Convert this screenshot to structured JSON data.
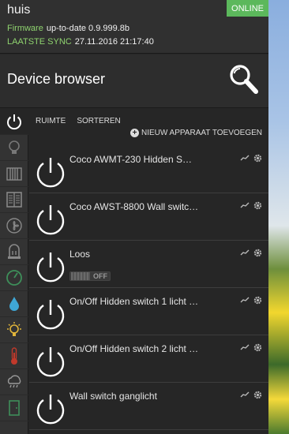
{
  "app": {
    "title": "huis",
    "status": "ONLINE"
  },
  "firmware": {
    "label": "Firmware",
    "value": "up-to-date 0.9.999.8b"
  },
  "sync": {
    "label": "LAATSTE SYNC",
    "value": "27.11.2016 21:17:40"
  },
  "header": {
    "title": "Device browser"
  },
  "tabs": [
    "RUIMTE",
    "SORTEREN"
  ],
  "add_device": "NIEUW APPARAAT TOEVOEGEN",
  "sidebar": [
    "power-icon",
    "bulb-icon",
    "radiator-icon",
    "window-icon",
    "fan-icon",
    "sensor-icon",
    "compass-icon",
    "water-drop-icon",
    "bright-bulb-icon",
    "thermometer-icon",
    "weather-icon",
    "door-icon"
  ],
  "devices": [
    {
      "name": "Coco AWMT-230 Hidden S…"
    },
    {
      "name": "Coco AWST-8800 Wall switc…"
    },
    {
      "name": "Loos",
      "toggle": "OFF"
    },
    {
      "name": "On/Off Hidden switch 1 licht …"
    },
    {
      "name": "On/Off Hidden switch 2 licht …"
    },
    {
      "name": "Wall switch ganglicht"
    }
  ],
  "colors": {
    "online": "#5cb85c",
    "info_label": "#8fd36f",
    "background": "#262626"
  }
}
